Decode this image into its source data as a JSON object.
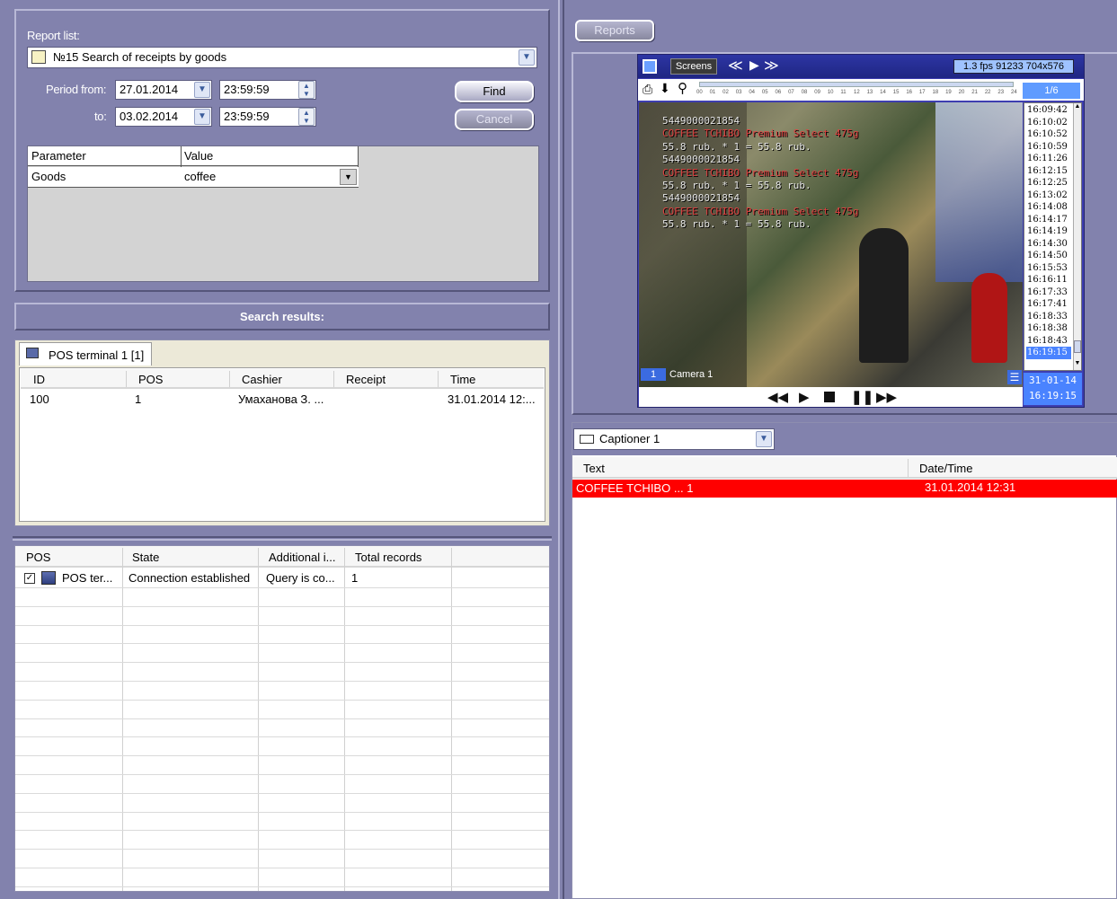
{
  "report_panel": {
    "report_list_label": "Report list:",
    "report_selected": "№15 Search of receipts by goods",
    "period_from_label": "Period from:",
    "period_from_date": "27.01.2014",
    "period_from_time": "23:59:59",
    "to_label": "to:",
    "to_date": "03.02.2014",
    "to_time": "23:59:59",
    "find_label": "Find",
    "cancel_label": "Cancel",
    "param_headers": [
      "Parameter",
      "Value"
    ],
    "param_rows": [
      {
        "parameter": "Goods",
        "value": "coffee"
      }
    ]
  },
  "search_results": {
    "title": "Search results:",
    "tab_label": "POS terminal 1 [1]",
    "columns": [
      "ID",
      "POS",
      "Cashier",
      "Receipt",
      "Time"
    ],
    "rows": [
      {
        "id": "100",
        "pos": "1",
        "cashier": "Умаханова З. ...",
        "receipt": "",
        "time": "31.01.2014 12:..."
      }
    ]
  },
  "pos_status": {
    "columns": [
      "POS",
      "State",
      "Additional i...",
      "Total records"
    ],
    "rows": [
      {
        "checked": true,
        "pos": "POS ter...",
        "state": "Connection established",
        "additional": "Query is co...",
        "total": "1"
      }
    ]
  },
  "video": {
    "reports_button": "Reports",
    "screens_button": "Screens",
    "fps_info": "1.3 fps  91233 704x576",
    "page_indicator": "1/6",
    "timeline_ticks": [
      "00",
      "01",
      "02",
      "03",
      "04",
      "05",
      "06",
      "07",
      "08",
      "09",
      "10",
      "11",
      "12",
      "13",
      "14",
      "15",
      "16",
      "17",
      "18",
      "19",
      "20",
      "21",
      "22",
      "23",
      "24"
    ],
    "overlay_lines": [
      {
        "text": "5449000021854",
        "color": "#e6e6e6"
      },
      {
        "text": "COFFEE TCHIBO Premium Select 475g",
        "color": "#e04040"
      },
      {
        "text": "55.8 rub. * 1 = 55.8 rub.",
        "color": "#e6e6e6"
      },
      {
        "text": "5449000021854",
        "color": "#e6e6e6"
      },
      {
        "text": "COFFEE TCHIBO Premium Select 475g",
        "color": "#e04040"
      },
      {
        "text": "55.8 rub. * 1 = 55.8 rub.",
        "color": "#e6e6e6"
      },
      {
        "text": "5449000021854",
        "color": "#e6e6e6"
      },
      {
        "text": "COFFEE TCHIBO Premium Select 475g",
        "color": "#e04040"
      },
      {
        "text": "55.8 rub. * 1 = 55.8 rub.",
        "color": "#e6e6e6"
      }
    ],
    "camera_number": "1",
    "camera_name": "Camera 1",
    "times": [
      "16:09:42",
      "16:10:02",
      "16:10:52",
      "16:10:59",
      "16:11:26",
      "16:12:15",
      "16:12:25",
      "16:13:02",
      "16:14:08",
      "16:14:17",
      "16:14:19",
      "16:14:30",
      "16:14:50",
      "16:15:53",
      "16:16:11",
      "16:17:33",
      "16:17:41",
      "16:18:33",
      "16:18:38",
      "16:18:43",
      "16:19:15"
    ],
    "selected_time": "16:19:15",
    "date_display": "31-01-14",
    "time_display": "16:19:15"
  },
  "captioner": {
    "selected": "Captioner 1",
    "columns": [
      "Text",
      "Date/Time"
    ],
    "rows": [
      {
        "text": "COFFEE TCHIBO ...  1",
        "datetime": "31.01.2014 12:31"
      }
    ]
  }
}
